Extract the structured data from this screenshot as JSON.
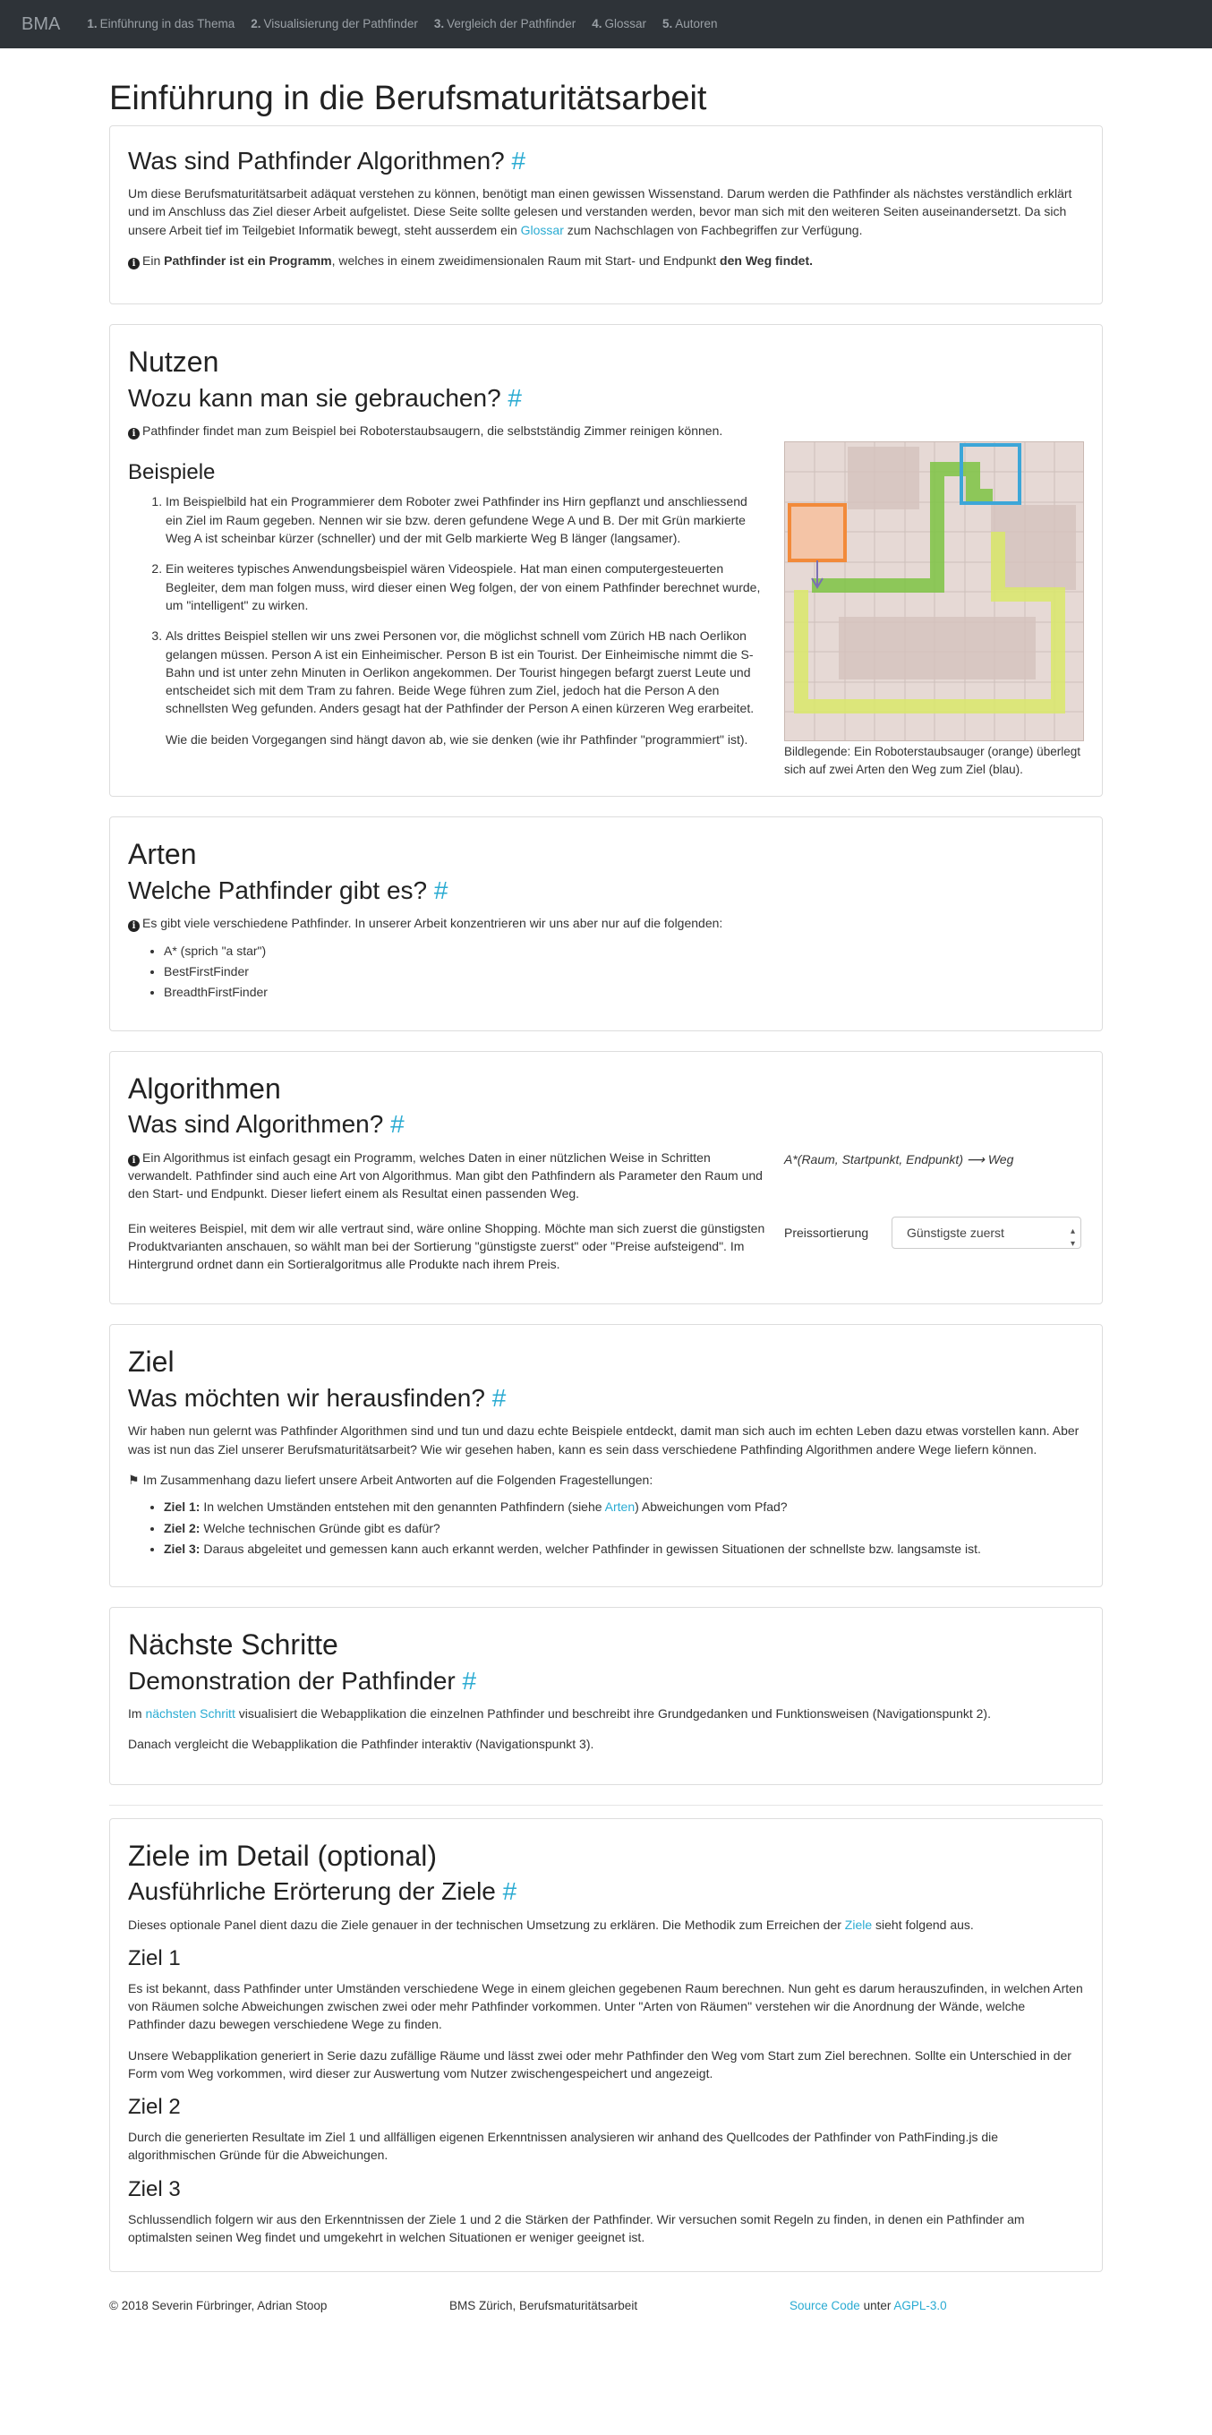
{
  "nav": {
    "brand": "BMA",
    "items": [
      {
        "num": "1.",
        "label": "Einführung in das Thema"
      },
      {
        "num": "2.",
        "label": "Visualisierung der Pathfinder"
      },
      {
        "num": "3.",
        "label": "Vergleich der Pathfinder"
      },
      {
        "num": "4.",
        "label": "Glossar"
      },
      {
        "num": "5.",
        "label": "Autoren"
      }
    ]
  },
  "page_title": "Einführung in die Berufsmaturitätsarbeit",
  "anchor": "#",
  "s1": {
    "heading": "Was sind Pathfinder Algorithmen?",
    "p1": "Um diese Berufsmaturitätsarbeit adäquat verstehen zu können, benötigt man einen gewissen Wissenstand. Darum werden die Pathfinder als nächstes verständlich erklärt und im Anschluss das Ziel dieser Arbeit aufgelistet. Diese Seite sollte gelesen und verstanden werden, bevor man sich mit den weiteren Seiten auseinandersetzt. Da sich unsere Arbeit tief im Teilgebiet Informatik bewegt, steht ausserdem ein ",
    "p1_link": "Glossar",
    "p1_end": " zum Nachschlagen von Fachbegriffen zur Verfügung.",
    "info_a": "Ein ",
    "info_b": "Pathfinder ist ein Programm",
    "info_c": ", welches in einem zweidimensionalen Raum mit Start- und Endpunkt ",
    "info_d": "den Weg findet."
  },
  "s2": {
    "title": "Nutzen",
    "heading": "Wozu kann man sie gebrauchen?",
    "info": "Pathfinder findet man zum Beispiel bei Roboterstaubsaugern, die selbstständig Zimmer reinigen können.",
    "sub": "Beispiele",
    "items": [
      "Im Beispielbild hat ein Programmierer dem Roboter zwei Pathfinder ins Hirn gepflanzt und anschliessend ein Ziel im Raum gegeben. Nennen wir sie bzw. deren gefundene Wege A und B. Der mit Grün markierte Weg A ist scheinbar kürzer (schneller) und der mit Gelb markierte Weg B länger (langsamer).",
      "Ein weiteres typisches Anwendungsbeispiel wären Videospiele. Hat man einen computergesteuerten Begleiter, dem man folgen muss, wird dieser einen Weg folgen, der von einem Pathfinder berechnet wurde, um \"intelligent\" zu wirken.",
      "Als drittes Beispiel stellen wir uns zwei Personen vor, die möglichst schnell vom Zürich HB nach Oerlikon gelangen müssen. Person A ist ein Einheimischer. Person B ist ein Tourist. Der Einheimische nimmt die S-Bahn und ist unter zehn Minuten in Oerlikon angekommen. Der Tourist hingegen befargt zuerst Leute und entscheidet sich mit dem Tram zu fahren. Beide Wege führen zum Ziel, jedoch hat die Person A den schnellsten Weg gefunden. Anders gesagt hat der Pathfinder der Person A einen kürzeren Weg erarbeitet."
    ],
    "after": "Wie die beiden Vorgegangen sind hängt davon ab, wie sie denken (wie ihr Pathfinder \"programmiert\" ist).",
    "caption": "Bildlegende: Ein Roboterstaubsauger (orange) überlegt sich auf zwei Arten den Weg zum Ziel (blau)."
  },
  "s3": {
    "title": "Arten",
    "heading": "Welche Pathfinder gibt es?",
    "info": "Es gibt viele verschiedene Pathfinder. In unserer Arbeit konzentrieren wir uns aber nur auf die folgenden:",
    "items": [
      "A* (sprich \"a star\")",
      "BestFirstFinder",
      "BreadthFirstFinder"
    ]
  },
  "s4": {
    "title": "Algorithmen",
    "heading": "Was sind Algorithmen?",
    "info": "Ein Algorithmus ist einfach gesagt ein Programm, welches Daten in einer nützlichen Weise in Schritten verwandelt. Pathfinder sind auch eine Art von Algorithmus. Man gibt den Pathfindern als Parameter den Raum und den Start- und Endpunkt. Dieser liefert einem als Resultat einen passenden Weg.",
    "p2": "Ein weiteres Beispiel, mit dem wir alle vertraut sind, wäre online Shopping. Möchte man sich zuerst die günstigsten Produktvarianten anschauen, so wählt man bei der Sortierung \"günstigste zuerst\" oder \"Preise aufsteigend\". Im Hintergrund ordnet dann ein Sortieralgoritmus alle Produkte nach ihrem Preis.",
    "formula": "A*(Raum, Startpunkt, Endpunkt) ⟶ Weg",
    "sort_label": "Preissortierung",
    "sort_value": "Günstigste zuerst"
  },
  "s5": {
    "title": "Ziel",
    "heading": "Was möchten wir herausfinden?",
    "p1": "Wir haben nun gelernt was Pathfinder Algorithmen sind und tun und dazu echte Beispiele entdeckt, damit man sich auch im echten Leben dazu etwas vorstellen kann. Aber was ist nun das Ziel unserer Berufsmaturitätsarbeit? Wie wir gesehen haben, kann es sein dass verschiedene Pathfinding Algorithmen andere Wege liefern können.",
    "flag_text": "Im Zusammenhang dazu liefert unsere Arbeit Antworten auf die Folgenden Fragestellungen:",
    "goals": [
      {
        "label": "Ziel 1:",
        "a": " In welchen Umständen entstehen mit den genannten Pathfindern (siehe ",
        "link": "Arten",
        "b": ") Abweichungen vom Pfad?"
      },
      {
        "label": "Ziel 2:",
        "a": " Welche technischen Gründe gibt es dafür?"
      },
      {
        "label": "Ziel 3:",
        "a": " Daraus abgeleitet und gemessen kann auch erkannt werden, welcher Pathfinder in gewissen Situationen der schnellste bzw. langsamste ist."
      }
    ]
  },
  "s6": {
    "title": "Nächste Schritte",
    "heading": "Demonstration der Pathfinder",
    "p1_a": "Im ",
    "p1_link": "nächsten Schritt",
    "p1_b": " visualisiert die Webapplikation die einzelnen Pathfinder und beschreibt ihre Grundgedanken und Funktionsweisen (Navigationspunkt 2).",
    "p2": "Danach vergleicht die Webapplikation die Pathfinder interaktiv (Navigationspunkt 3)."
  },
  "s7": {
    "title": "Ziele im Detail (optional)",
    "heading": "Ausführliche Erörterung der Ziele",
    "intro_a": "Dieses optionale Panel dient dazu die Ziele genauer in der technischen Umsetzung zu erklären. Die Methodik zum Erreichen der ",
    "intro_link": "Ziele",
    "intro_b": " sieht folgend aus.",
    "z1_title": "Ziel 1",
    "z1_p1": "Es ist bekannt, dass Pathfinder unter Umständen verschiedene Wege in einem gleichen gegebenen Raum berechnen. Nun geht es darum herauszufinden, in welchen Arten von Räumen solche Abweichungen zwischen zwei oder mehr Pathfinder vorkommen. Unter \"Arten von Räumen\" verstehen wir die Anordnung der Wände, welche Pathfinder dazu bewegen verschiedene Wege zu finden.",
    "z1_p2": "Unsere Webapplikation generiert in Serie dazu zufällige Räume und lässt zwei oder mehr Pathfinder den Weg vom Start zum Ziel berechnen. Sollte ein Unterschied in der Form vom Weg vorkommen, wird dieser zur Auswertung vom Nutzer zwischengespeichert und angezeigt.",
    "z2_title": "Ziel 2",
    "z2_p": "Durch die generierten Resultate im Ziel 1 und allfälligen eigenen Erkenntnissen analysieren wir anhand des Quellcodes der Pathfinder von PathFinding.js die algorithmischen Gründe für die Abweichungen.",
    "z3_title": "Ziel 3",
    "z3_p": "Schlussendlich folgern wir aus den Erkenntnissen der Ziele 1 und 2 die Stärken der Pathfinder. Wir versuchen somit Regeln zu finden, in denen ein Pathfinder am optimalsten seinen Weg findet und umgekehrt in welchen Situationen er weniger geeignet ist."
  },
  "footer": {
    "copyright": "© 2018 Severin Fürbringer, Adrian Stoop",
    "school": "BMS Zürich, Berufsmaturitätsarbeit",
    "source_link": "Source Code",
    "under": " unter ",
    "license_link": "AGPL-3.0"
  },
  "colors": {
    "navbar_bg": "#2e3338",
    "link": "#2aabd2",
    "path_a_green": "#7cc343",
    "path_b_yellow": "#d9e86a",
    "robot_orange": "#f28a3a",
    "goal_blue": "#3ca6d8"
  }
}
